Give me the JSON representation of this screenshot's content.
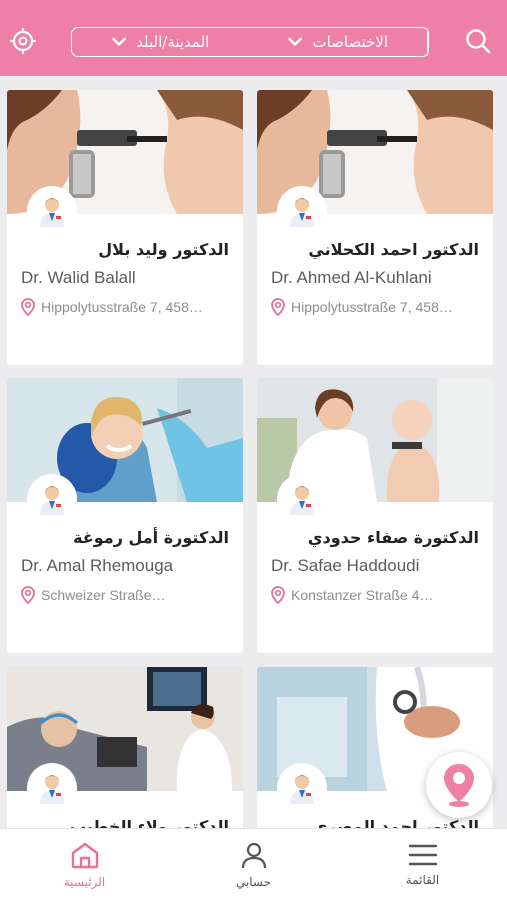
{
  "header": {
    "locate_icon": "crosshair-icon",
    "search_icon": "search-icon",
    "filter_city": "المدينة/البلد",
    "filter_specialty": "الاختصاصات",
    "background_color": "#ee7fa6"
  },
  "doctors": [
    {
      "name_ar": "الدكتور احمد الكحلاني",
      "name_en": "Dr. Ahmed Al-Kuhlani",
      "address": "Hippolytusstraße 7, 458…"
    },
    {
      "name_ar": "الدكتور وليد بلال",
      "name_en": "Dr. Walid Balall",
      "address": "Hippolytusstraße 7, 458…"
    },
    {
      "name_ar": "الدكتورة صفاء حدودي",
      "name_en": "Dr. Safae Haddoudi",
      "address": "Konstanzer Straße 4…"
    },
    {
      "name_ar": "الدكتورة أمل رموغة",
      "name_en": "Dr. Amal Rhemouga",
      "address": "Schweizer Straße…"
    },
    {
      "name_ar": "الدكتور احمد المصري",
      "name_en": "",
      "address": ""
    },
    {
      "name_ar": "الدكتور ولاء الخطيب",
      "name_en": "",
      "address": ""
    }
  ],
  "map_button_icon": "map-pin-icon",
  "bottom_nav": {
    "home_label": "الرئيسية",
    "account_label": "حسابي",
    "menu_label": "القائمة",
    "active_color": "#e86f9b"
  }
}
